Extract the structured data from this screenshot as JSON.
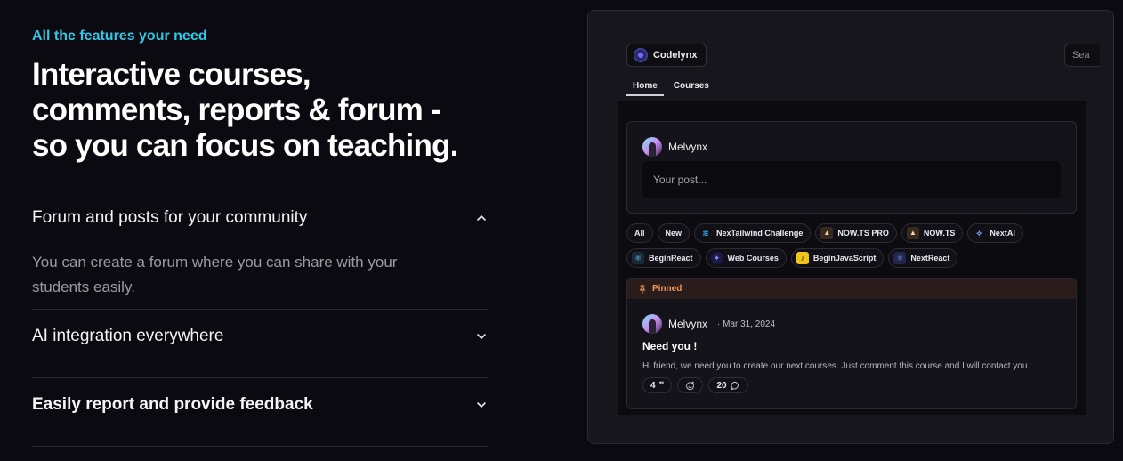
{
  "hero": {
    "eyebrow": "All the features your need",
    "headline_lines": [
      "Interactive courses,",
      "comments, reports & forum -",
      "so you can focus on teaching."
    ]
  },
  "accordion": [
    {
      "title": "Forum and posts for your community",
      "expanded": true,
      "body_lines": [
        "You can create a forum where you can share with your",
        "students easily."
      ]
    },
    {
      "title": "AI integration everywhere",
      "expanded": false
    },
    {
      "title": "Easily report and provide feedback",
      "expanded": false
    }
  ],
  "preview": {
    "brand": "Codelynx",
    "search_placeholder": "Sea",
    "nav": [
      "Home",
      "Courses"
    ],
    "composer": {
      "user": "Melvynx",
      "placeholder": "Your post..."
    },
    "chips_row1": [
      {
        "label": "All",
        "icon": "none"
      },
      {
        "label": "New",
        "icon": "none"
      },
      {
        "label": "NexTailwind Challenge",
        "icon": "tailwind-icon"
      },
      {
        "label": "NOW.TS PRO",
        "icon": "now-ts-icon"
      },
      {
        "label": "NOW.TS",
        "icon": "now-ts-icon"
      },
      {
        "label": "NextAI",
        "icon": "rocket-icon"
      }
    ],
    "chips_row2": [
      {
        "label": "BeginReact",
        "icon": "react-icon"
      },
      {
        "label": "Web Courses",
        "icon": "web-courses-icon"
      },
      {
        "label": "BeginJavaScript",
        "icon": "javascript-icon"
      },
      {
        "label": "NextReact",
        "icon": "next-react-icon"
      }
    ],
    "post": {
      "pinned_label": "Pinned",
      "author": "Melvynx",
      "date": "· Mar 31, 2024",
      "title": "Need you !",
      "text": "Hi friend, we need you to create our next courses. Just comment this course and I will contact you.",
      "quote_count": "4",
      "comment_count": "20"
    },
    "colors": {
      "accent_cyan": "#31c8e8",
      "pinned_orange": "#f09a5a",
      "background": "#0b0a10"
    }
  }
}
